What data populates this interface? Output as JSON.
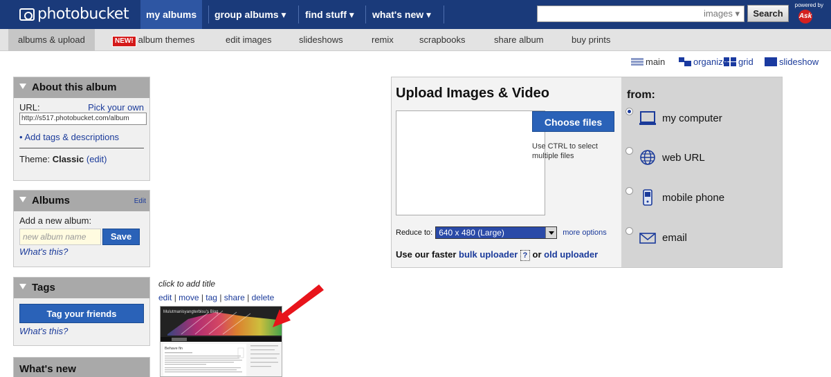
{
  "topbar": {
    "logo": "photobucket",
    "tabs": [
      {
        "label": "my albums"
      },
      {
        "label": "group albums ▾"
      },
      {
        "label": "find stuff ▾"
      },
      {
        "label": "what's new ▾"
      }
    ],
    "search": {
      "value": "",
      "scope": "images ▾",
      "button": "Search"
    },
    "powered_by": "powered by",
    "ask": "Ask"
  },
  "subnav": {
    "new_badge": "NEW!",
    "tabs": [
      {
        "label": "albums & upload"
      },
      {
        "label": "album themes"
      },
      {
        "label": "edit images"
      },
      {
        "label": "slideshows"
      },
      {
        "label": "remix"
      },
      {
        "label": "scrapbooks"
      },
      {
        "label": "share album"
      },
      {
        "label": "buy prints"
      }
    ]
  },
  "views": {
    "main": "main",
    "organize": "organize",
    "grid": "grid",
    "slideshow": "slideshow"
  },
  "about": {
    "title": "About this album",
    "url_label": "URL:",
    "pick_own": "Pick your own",
    "url_value": "http://s517.photobucket.com/album",
    "add_tags": "Add tags & descriptions",
    "theme_label": "Theme:",
    "theme_value": "Classic",
    "theme_edit": "(edit)"
  },
  "albums": {
    "title": "Albums",
    "edit": "Edit",
    "add_label": "Add a new album:",
    "placeholder": "new album name",
    "save": "Save",
    "whats_this": "What's this?"
  },
  "tags": {
    "title": "Tags",
    "button": "Tag your friends",
    "whats_this": "What's this?"
  },
  "whats_new": {
    "title": "What's new"
  },
  "upload": {
    "title": "Upload Images & Video",
    "choose": "Choose files",
    "ctrl_hint": "Use CTRL to select multiple files",
    "reduce_label": "Reduce to:",
    "reduce_value": "640 x 480 (Large)",
    "more_options": "more options",
    "faster_prefix": "Use our faster",
    "bulk": "bulk uploader",
    "q": "?",
    "or": "or",
    "old": "old uploader",
    "from": "from:",
    "sources": [
      {
        "label": "my computer",
        "icon": "monitor-icon",
        "selected": true
      },
      {
        "label": "web URL",
        "icon": "globe-icon",
        "selected": false
      },
      {
        "label": "mobile phone",
        "icon": "phone-icon",
        "selected": false
      },
      {
        "label": "email",
        "icon": "envelope-icon",
        "selected": false
      }
    ]
  },
  "item": {
    "title": "click to add title",
    "actions": [
      "edit",
      "move",
      "tag",
      "share",
      "delete"
    ],
    "blog_title": "Mulutmanisyangterbisu's Blog",
    "post_title": "Behave fin"
  },
  "colors": {
    "nav": "#1a3a7a",
    "link": "#1a3a9a",
    "button": "#2a62b8",
    "arrow": "#e8141b"
  }
}
